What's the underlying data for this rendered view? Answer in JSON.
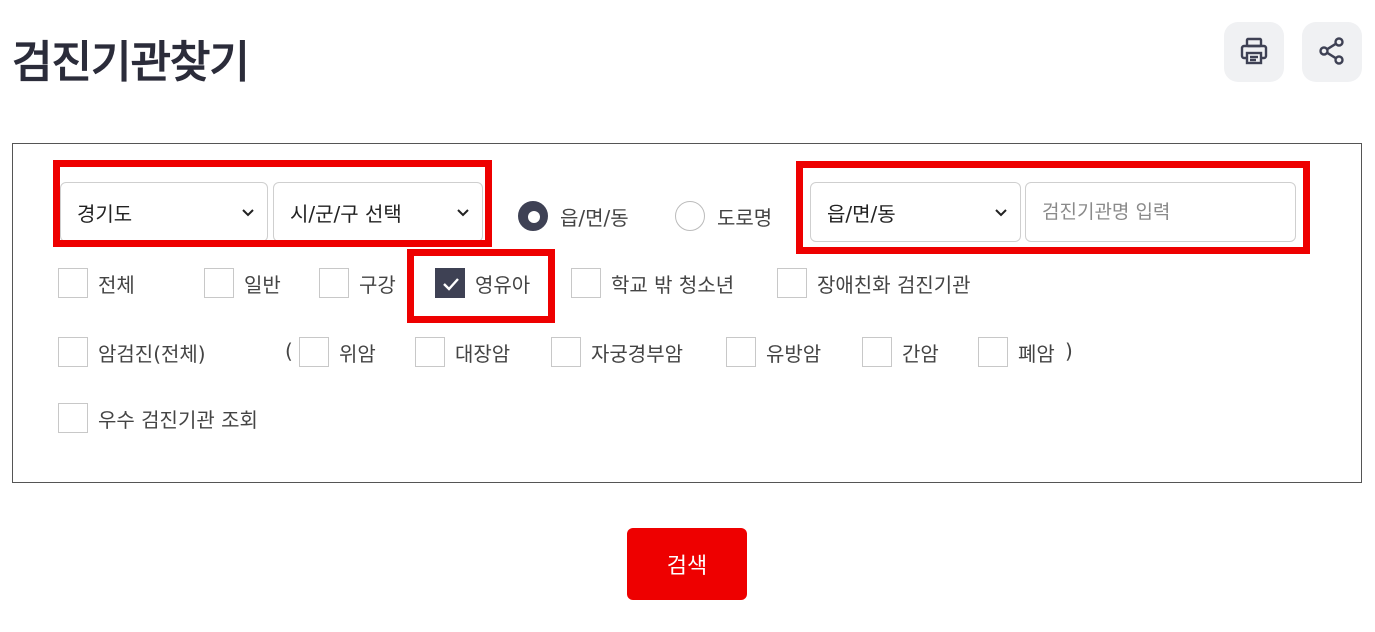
{
  "page": {
    "title": "검진기관찾기"
  },
  "toolbar": {
    "print_icon": "printer-icon",
    "share_icon": "share-icon"
  },
  "region": {
    "province": "경기도",
    "city": "시/군/구 선택",
    "address_type_options": [
      {
        "label": "읍/면/동",
        "selected": true
      },
      {
        "label": "도로명",
        "selected": false
      }
    ],
    "district": "읍/면/동",
    "name_placeholder": "검진기관명 입력"
  },
  "checkup_types": [
    {
      "label": "전체",
      "checked": false
    },
    {
      "label": "일반",
      "checked": false
    },
    {
      "label": "구강",
      "checked": false
    },
    {
      "label": "영유아",
      "checked": true
    },
    {
      "label": "학교 밖 청소년",
      "checked": false
    },
    {
      "label": "장애친화 검진기관",
      "checked": false
    }
  ],
  "cancer": {
    "all_label": "암검진(전체)",
    "open_paren": "(",
    "close_paren": ")",
    "types": [
      {
        "label": "위암",
        "checked": false
      },
      {
        "label": "대장암",
        "checked": false
      },
      {
        "label": "자궁경부암",
        "checked": false
      },
      {
        "label": "유방암",
        "checked": false
      },
      {
        "label": "간암",
        "checked": false
      },
      {
        "label": "폐암",
        "checked": false
      }
    ]
  },
  "excellent": {
    "label": "우수 검진기관 조회",
    "checked": false
  },
  "actions": {
    "search_label": "검색"
  },
  "colors": {
    "accent": "#ee0000",
    "dark": "#3e4154",
    "highlight": "#ee0000"
  }
}
